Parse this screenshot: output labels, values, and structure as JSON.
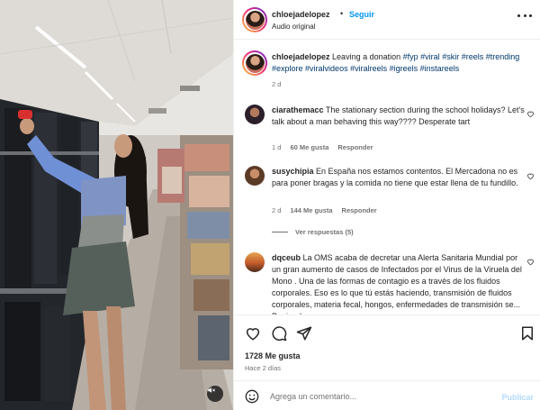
{
  "header": {
    "username": "chloejadelopez",
    "separator": "•",
    "follow_label": "Seguir",
    "audio_label": "Audio original"
  },
  "caption": {
    "username": "chloejadelopez",
    "text": "Leaving a donation",
    "hashtags": [
      "#fyp",
      "#viral",
      "#skir",
      "#reels",
      "#trending",
      "#explore",
      "#viralvideos",
      "#viralreels",
      "#igreels",
      "#instareels"
    ],
    "time": "2 d"
  },
  "comments": [
    {
      "username": "ciarathemacc",
      "text": "The stationary section during the school holidays? Let's talk about a man behaving this way???? Desperate tart",
      "time": "1 d",
      "likes": "60 Me gusta",
      "reply_label": "Responder"
    },
    {
      "username": "susychipia",
      "text": "En España nos estamos contentos. El Mercadona no es para poner bragas y la comida no tiene que estar llena de tu fundillo.",
      "time": "2 d",
      "likes": "144 Me gusta",
      "reply_label": "Responder",
      "view_replies": "Ver respuestas (5)"
    },
    {
      "username": "dqceub",
      "text": "La OMS acaba de decretar una Alerta Sanitaria Mundial por un gran aumento de casos de Infectados por el Virus de la Viruela del Mono . Una de las formas de contagio es a través de los fluidos corporales. Eso es lo que tú estás haciendo, transmisión de fluidos corporales, materia fecal, hongos, enfermedades de transmisión se... Poniendo en"
    }
  ],
  "actions": {
    "likes": "1728 Me gusta",
    "date": "Hace 2 días"
  },
  "comment_bar": {
    "placeholder": "Agrega un comentario...",
    "publish_label": "Publicar"
  },
  "colors": {
    "link_blue": "#0095f6",
    "hashtag": "#00376b",
    "muted": "#737373",
    "publish_disabled": "#b3dbff"
  },
  "icons": [
    "heart-icon",
    "comment-icon",
    "share-icon",
    "bookmark-icon",
    "emoji-icon",
    "mute-icon",
    "more-icon"
  ]
}
